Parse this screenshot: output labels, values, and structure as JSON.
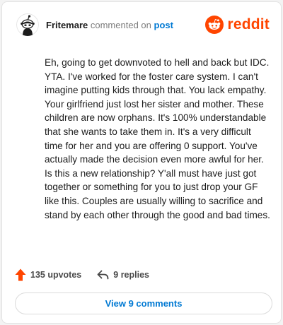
{
  "header": {
    "username": "Fritemare",
    "action_text": "commented on",
    "post_link": "post",
    "logo_text": "reddit",
    "brand_color": "#ff4500",
    "link_color": "#0079d3",
    "avatar_icon": "snoo-avatar-icon",
    "logo_icon": "reddit-snoo-icon"
  },
  "comment": {
    "text": "Eh, going to get downvoted to hell and back but IDC. YTA. I've worked for the foster care system. I can't imagine putting kids through that. You lack empathy. Your girlfriend just lost her sister and mother. These children are now orphans. It's 100% understandable that she wants to take them in. It's a very difficult time for her and you are offering 0 support. You've actually made the decision even more awful for her. Is this a new relationship? Y'all must have just got together or something for you to just drop your GF like this. Couples are usually willing to sacrifice and stand by each other through the good and bad times."
  },
  "actions": {
    "upvotes_label": "135 upvotes",
    "replies_label": "9 replies",
    "upvote_icon": "upvote-arrow-icon",
    "reply_icon": "reply-arrow-icon"
  },
  "footer": {
    "view_comments_label": "View 9 comments"
  }
}
